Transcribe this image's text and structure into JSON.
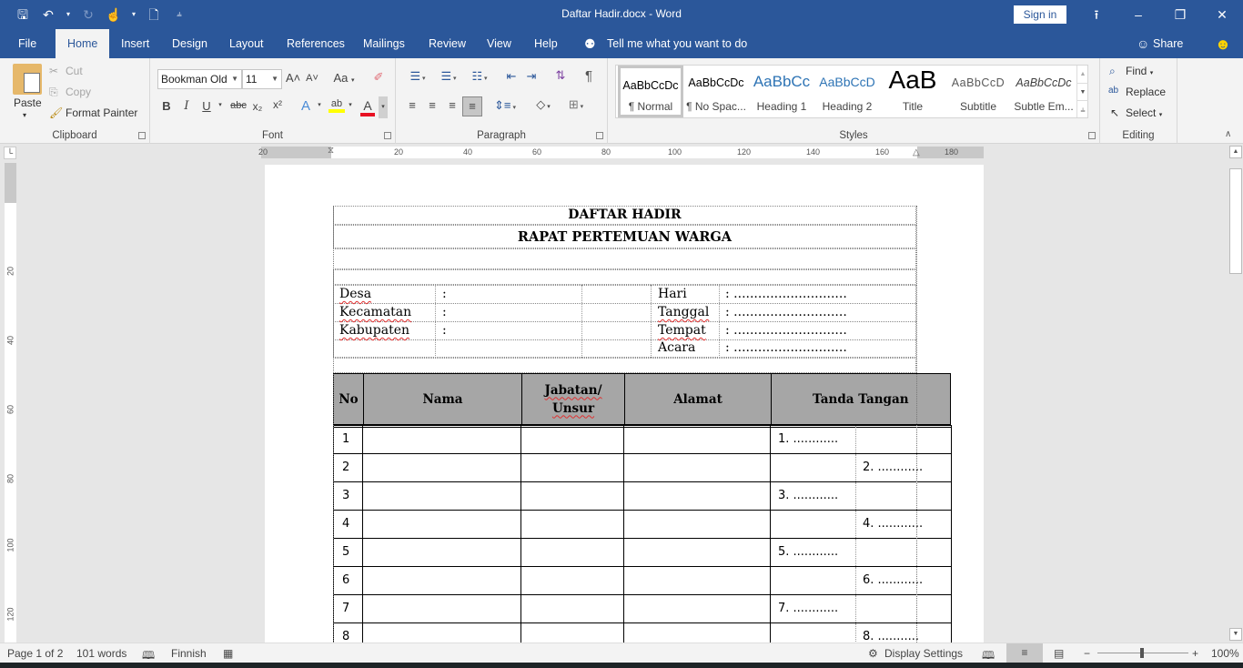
{
  "window": {
    "title": "Daftar Hadir.docx  -  Word",
    "sign_in": "Sign in",
    "qat": {
      "save": "save-icon",
      "undo": "undo-icon",
      "redo": "redo-icon",
      "touch": "touch-mode-icon",
      "new": "new-document-icon",
      "customize": "customize-qat-icon"
    }
  },
  "menu": {
    "tabs": [
      "File",
      "Home",
      "Insert",
      "Design",
      "Layout",
      "References",
      "Mailings",
      "Review",
      "View",
      "Help"
    ],
    "active_tab": "Home",
    "tell_me": "Tell me what you want to do",
    "share": "Share"
  },
  "ribbon": {
    "clipboard": {
      "label": "Clipboard",
      "paste": "Paste",
      "cut": "Cut",
      "copy": "Copy",
      "format_painter": "Format Painter"
    },
    "font": {
      "label": "Font",
      "font_name": "Bookman Old",
      "font_size": "11",
      "change_case": "Aa",
      "colors": {
        "highlight": "#ffff00",
        "font_color": "#e81123"
      }
    },
    "paragraph": {
      "label": "Paragraph"
    },
    "styles": {
      "label": "Styles",
      "items": [
        {
          "preview": "AaBbCcDc",
          "name": "¶ Normal",
          "color": "#000000"
        },
        {
          "preview": "AaBbCcDc",
          "name": "¶ No Spac...",
          "color": "#000000"
        },
        {
          "preview": "AaBbCc",
          "name": "Heading 1",
          "color": "#2e74b5"
        },
        {
          "preview": "AaBbCcD",
          "name": "Heading 2",
          "color": "#2e74b5"
        },
        {
          "preview": "AaB",
          "name": "Title",
          "color": "#000000"
        },
        {
          "preview": "AaBbCcD",
          "name": "Subtitle",
          "color": "#595959"
        },
        {
          "preview": "AaBbCcDc",
          "name": "Subtle Em...",
          "color": "#404040"
        }
      ]
    },
    "editing": {
      "label": "Editing",
      "find": "Find",
      "replace": "Replace",
      "select": "Select"
    }
  },
  "ruler": {
    "h_ticks": [
      "20",
      "20",
      "40",
      "60",
      "80",
      "100",
      "120",
      "140",
      "160",
      "180"
    ],
    "v_ticks": [
      "20",
      "40",
      "60",
      "80",
      "100",
      "120"
    ]
  },
  "document": {
    "title": "DAFTAR HADIR",
    "subtitle": "RAPAT PERTEMUAN WARGA",
    "left_info": [
      {
        "label": "Desa",
        "sep": ":"
      },
      {
        "label": "Kecamatan",
        "sep": ":"
      },
      {
        "label": "Kabupaten",
        "sep": ":"
      }
    ],
    "right_info": [
      {
        "label": "Hari",
        "value": ": ............................"
      },
      {
        "label": "Tanggal",
        "value": ": ............................"
      },
      {
        "label": "Tempat",
        "value": ": ............................"
      },
      {
        "label": "Acara",
        "value": ": ............................"
      }
    ],
    "table": {
      "headers": [
        "No",
        "Nama",
        "Jabatan/ Unsur",
        "Alamat",
        "Tanda Tangan"
      ],
      "rows": [
        {
          "no": "1",
          "sign": "1. ............"
        },
        {
          "no": "2",
          "sign": "2. ............"
        },
        {
          "no": "3",
          "sign": "3. ............"
        },
        {
          "no": "4",
          "sign": "4. ............"
        },
        {
          "no": "5",
          "sign": "5. ............"
        },
        {
          "no": "6",
          "sign": "6. ............"
        },
        {
          "no": "7",
          "sign": "7. ............"
        },
        {
          "no": "8",
          "sign": "8.  ..........."
        }
      ]
    }
  },
  "status": {
    "page": "Page 1 of 2",
    "words": "101 words",
    "language": "Finnish",
    "display_settings": "Display Settings",
    "zoom": "100%",
    "zoom_minus": "−",
    "zoom_plus": "+"
  }
}
